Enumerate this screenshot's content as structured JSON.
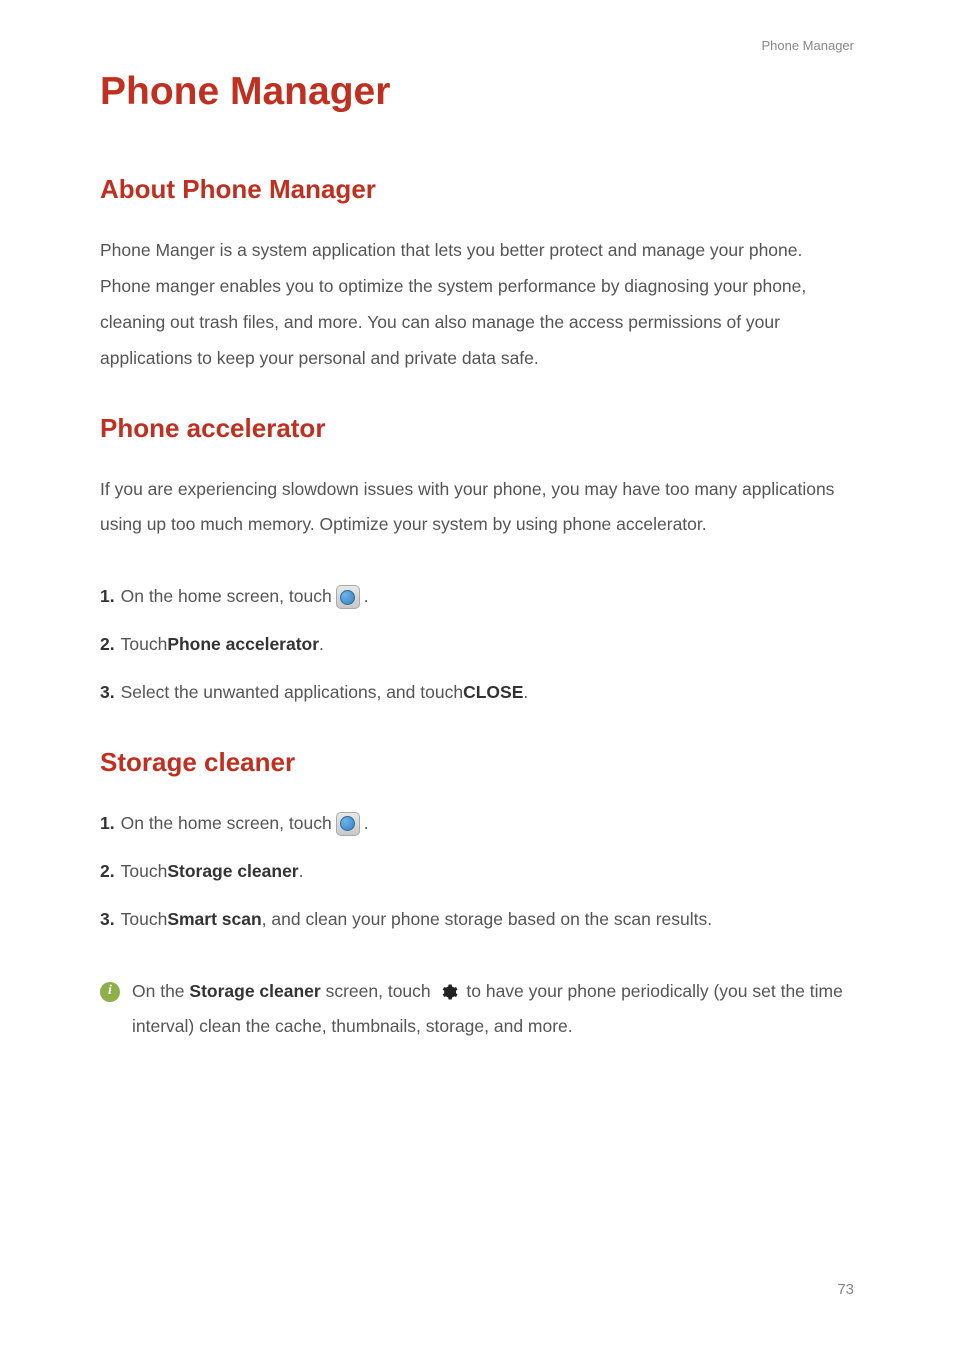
{
  "header": {
    "sectionLabel": "Phone Manager"
  },
  "title": "Phone Manager",
  "sections": {
    "about": {
      "heading": "About Phone Manager",
      "body": "Phone Manger is a system application that lets you better protect and manage your phone. Phone manger enables you to optimize the system performance by diagnosing your phone, cleaning out trash files, and more. You can also manage the access permissions of your applications to keep your personal and private data safe."
    },
    "accelerator": {
      "heading": "Phone accelerator",
      "body": "If you are experiencing slowdown issues with your phone, you may have too many applications using up too much memory. Optimize your system by using phone accelerator.",
      "steps": {
        "s1": {
          "num": "1.",
          "textA": "On the home screen, touch",
          "textB": "."
        },
        "s2": {
          "num": "2.",
          "textA": "Touch ",
          "bold": "Phone accelerator",
          "textB": "."
        },
        "s3": {
          "num": "3.",
          "textA": "Select the unwanted applications, and touch ",
          "bold": "CLOSE",
          "textB": "."
        }
      }
    },
    "cleaner": {
      "heading": "Storage cleaner",
      "steps": {
        "s1": {
          "num": "1.",
          "textA": "On the home screen, touch",
          "textB": "."
        },
        "s2": {
          "num": "2.",
          "textA": "Touch ",
          "bold": "Storage cleaner",
          "textB": "."
        },
        "s3": {
          "num": "3.",
          "textA": "Touch ",
          "bold": "Smart scan",
          "textB": ", and clean your phone storage based on the scan results."
        }
      },
      "tip": {
        "textA": "On the ",
        "bold1": "Storage cleaner",
        "textB": " screen, touch ",
        "textC": " to have your phone periodically (you set the time interval) clean the cache, thumbnails, storage, and more."
      }
    }
  },
  "pageNumber": "73",
  "icons": {
    "tipGlyph": "i"
  }
}
